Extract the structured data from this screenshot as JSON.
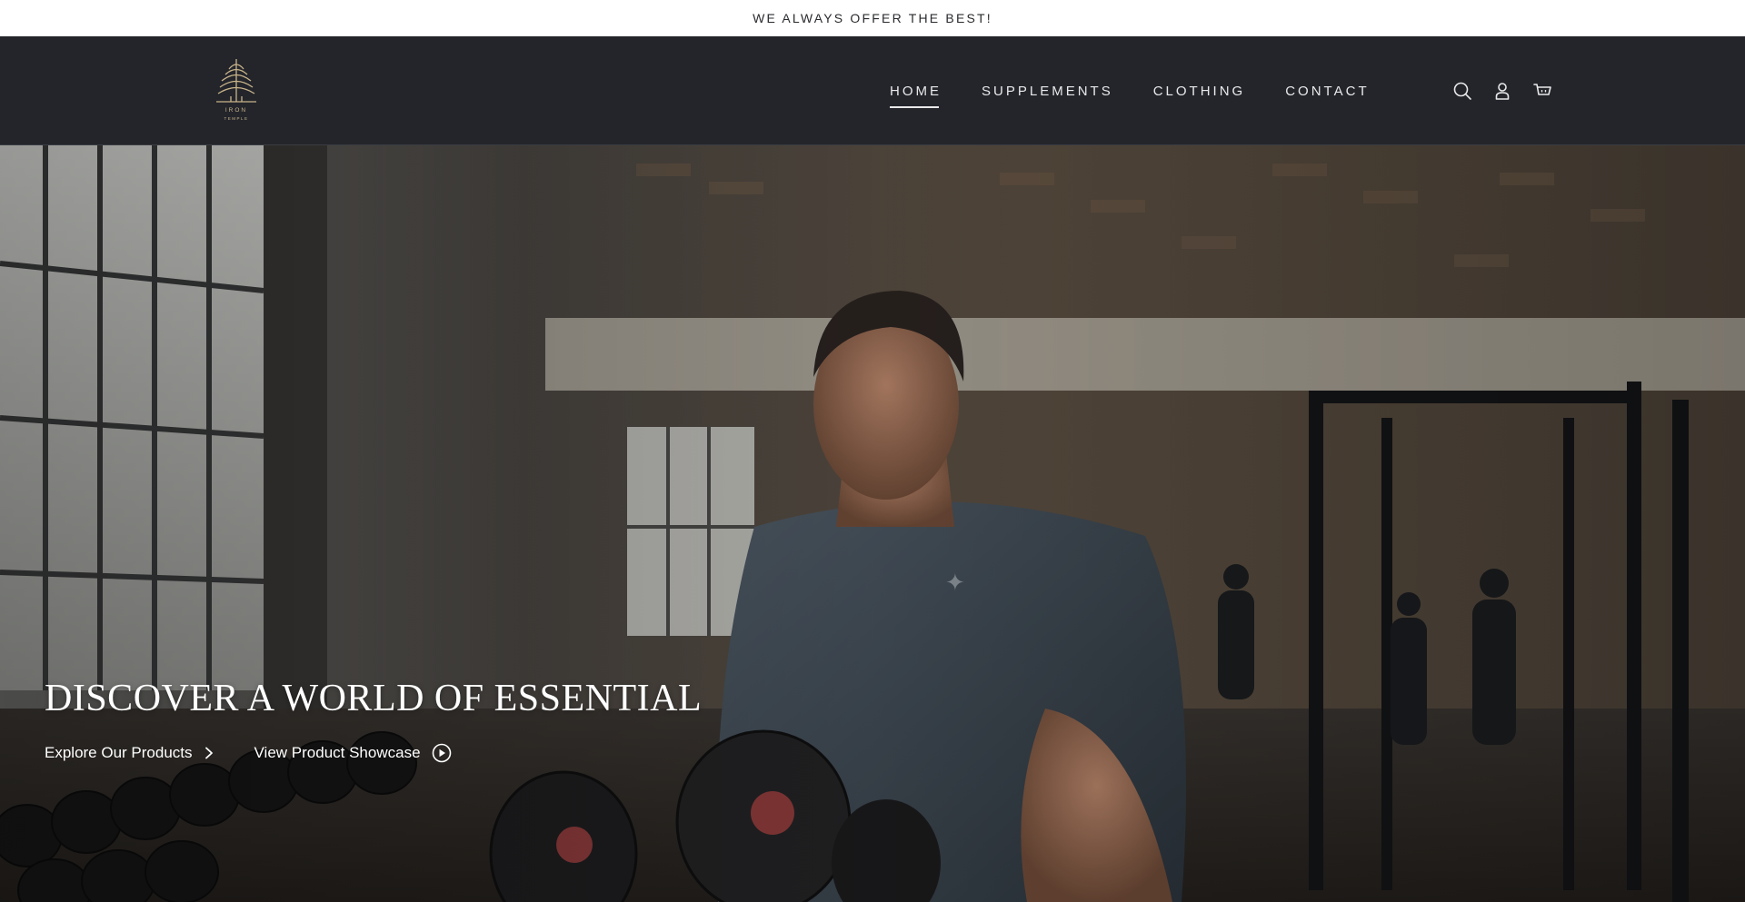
{
  "announcement": {
    "text": "WE ALWAYS OFFER THE BEST!"
  },
  "header": {
    "logo": {
      "line1": "IRON",
      "line2": "TEMPLE"
    },
    "nav": [
      {
        "label": "HOME",
        "active": true
      },
      {
        "label": "SUPPLEMENTS",
        "active": false
      },
      {
        "label": "CLOTHING",
        "active": false
      },
      {
        "label": "CONTACT",
        "active": false
      }
    ],
    "icons": [
      "search-icon",
      "account-icon",
      "cart-icon"
    ]
  },
  "hero": {
    "title": "DISCOVER A WORLD OF ESSENTIAL",
    "primary_link": "Explore Our Products",
    "secondary_link": "View Product Showcase"
  },
  "colors": {
    "header_bg": "#23252b",
    "announcement_bg": "#ffffff",
    "text_light": "#e9e9ea",
    "logo_gold": "#c9b48a"
  }
}
